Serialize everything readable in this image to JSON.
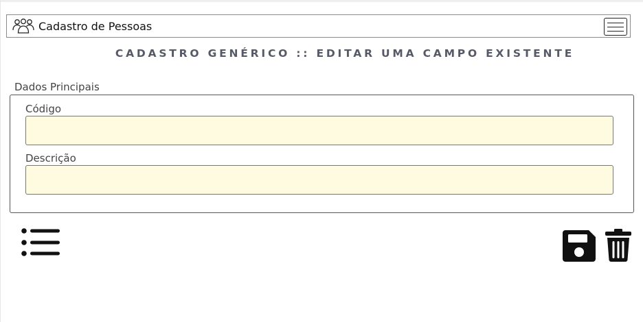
{
  "navbar": {
    "brand_icon": "users-icon",
    "title": "Cadastro de Pessoas",
    "toggle_icon": "hamburger-menu-icon"
  },
  "page": {
    "title": "CADASTRO GENÉRICO :: EDITAR UMA CAMPO EXISTENTE"
  },
  "form": {
    "legend": "Dados Principais",
    "fields": [
      {
        "label": "Código",
        "value": "",
        "placeholder": ""
      },
      {
        "label": "Descrição",
        "value": "",
        "placeholder": ""
      }
    ],
    "input_background": "#fefbe1"
  },
  "actions": {
    "list_icon": "list-icon",
    "save_icon": "floppy-disk-icon",
    "delete_icon": "trash-icon"
  }
}
